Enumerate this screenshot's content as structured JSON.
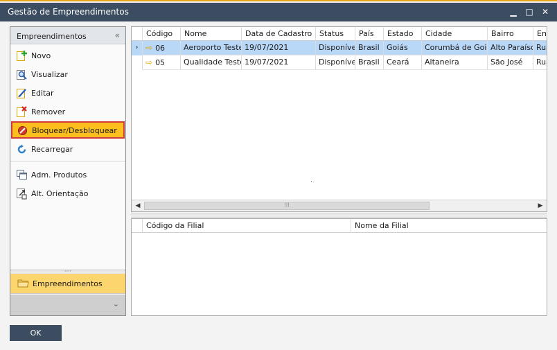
{
  "window": {
    "title": "Gestão de Empreendimentos",
    "controls": {
      "minimize": "▁",
      "maximize": "□",
      "close": "✕"
    },
    "accent_color": "#e8a317",
    "titlebar_color": "#3c4d62"
  },
  "sidebar": {
    "header": "Empreendimentos",
    "collapse_glyph": "«",
    "actions": [
      {
        "label": "Novo",
        "icon": "new-document-icon"
      },
      {
        "label": "Visualizar",
        "icon": "view-search-icon"
      },
      {
        "label": "Editar",
        "icon": "edit-pencil-icon"
      },
      {
        "label": "Remover",
        "icon": "remove-x-icon"
      },
      {
        "label": "Bloquear/Desbloquear",
        "icon": "block-icon",
        "selected": true
      },
      {
        "label": "Recarregar",
        "icon": "reload-icon"
      }
    ],
    "tools": [
      {
        "label": "Adm. Produtos",
        "icon": "windows-icon"
      },
      {
        "label": "Alt. Orientação",
        "icon": "orientation-icon"
      }
    ],
    "module": {
      "label": "Empreendimentos",
      "icon": "folder-icon"
    },
    "footer_glyph": "⌄",
    "selected_color": "#fcbf1e",
    "selected_border": "#d33b3b"
  },
  "main_grid": {
    "columns": [
      "Código",
      "Nome",
      "Data de Cadastro",
      "Status",
      "País",
      "Estado",
      "Cidade",
      "Bairro",
      "Endereço"
    ],
    "rows": [
      {
        "codigo": "06",
        "nome": "Aeroporto Teste",
        "data": "19/07/2021",
        "status": "Disponível",
        "pais": "Brasil",
        "estado": "Goiás",
        "cidade": "Corumbá de Goiás",
        "bairro": "Alto Paraíso",
        "endereco": "Rua",
        "active": true
      },
      {
        "codigo": "05",
        "nome": "Qualidade Teste",
        "data": "19/07/2021",
        "status": "Disponível",
        "pais": "Brasil",
        "estado": "Ceará",
        "cidade": "Altaneira",
        "bairro": "São José",
        "endereco": "Rua",
        "active": false
      }
    ],
    "row_indicator": "›",
    "link_arrow": "⇨",
    "active_row_color": "#b9d7f7"
  },
  "scrollbar": {
    "left": "◀",
    "right": "▶",
    "grip": "⁞⁞⁞"
  },
  "branch_grid": {
    "columns": [
      "Código da Filial",
      "Nome da Filial"
    ]
  },
  "footer": {
    "ok_label": "OK"
  }
}
